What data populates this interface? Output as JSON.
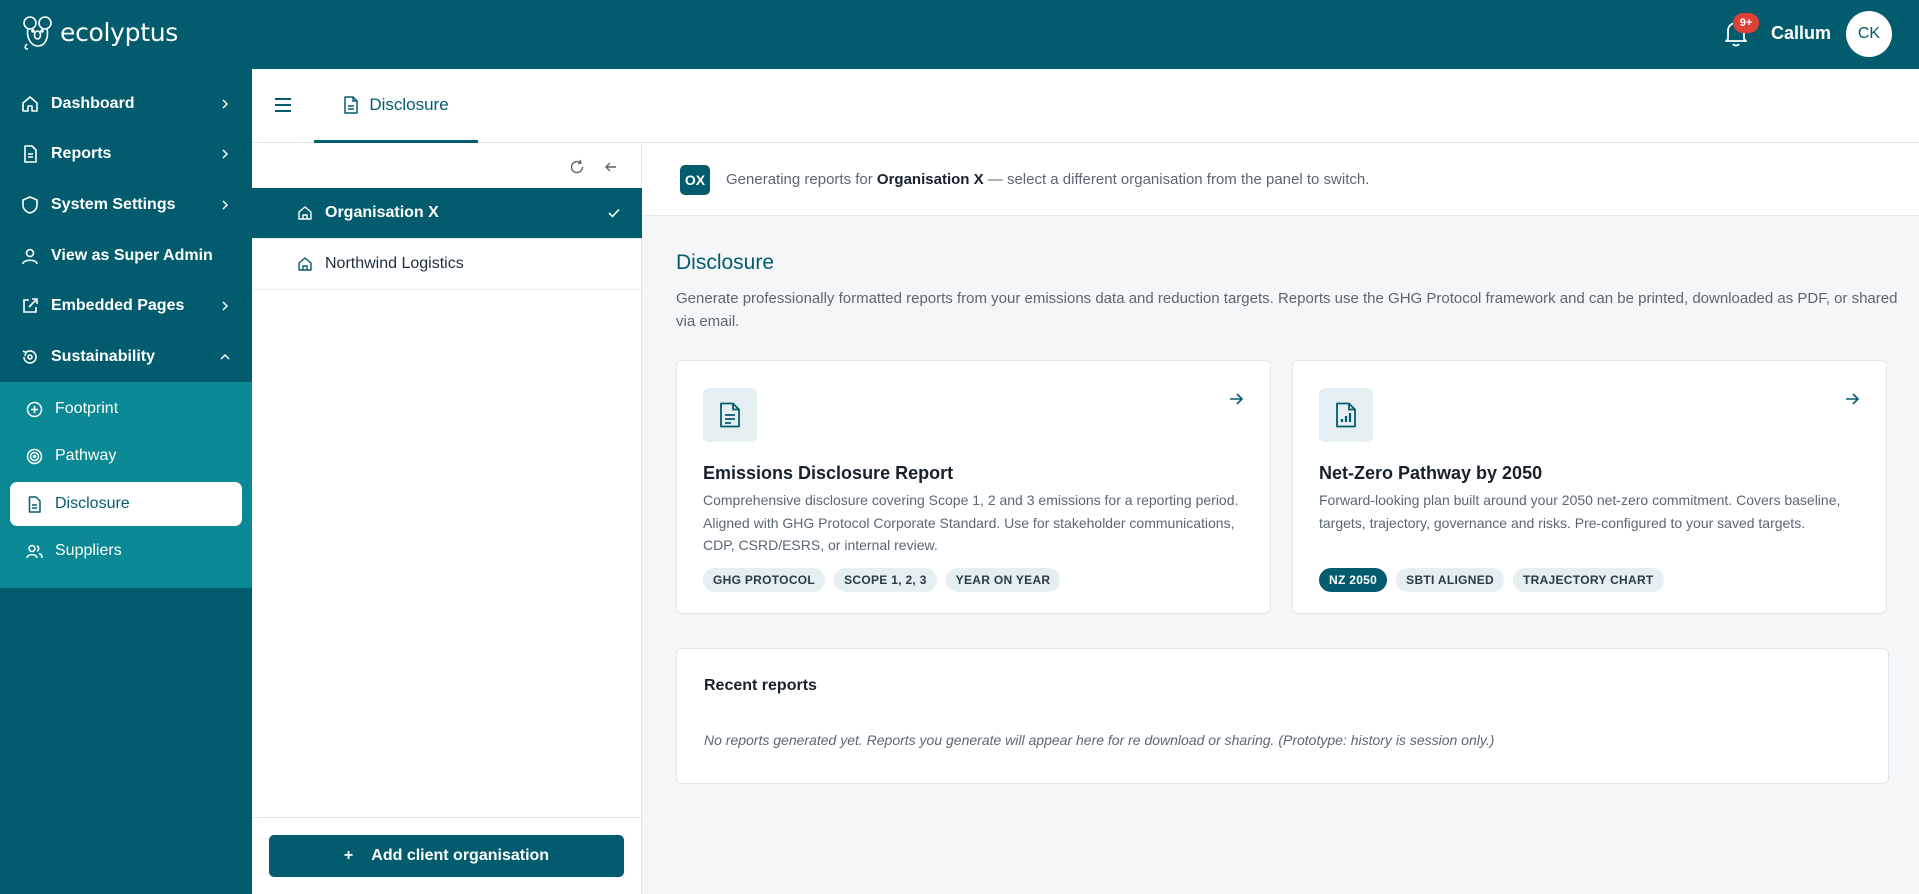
{
  "app": {
    "brand_name": "ecolyptus",
    "notification_badge": "9+",
    "user_name": "Callum",
    "user_initials": "CK"
  },
  "sidebar": {
    "items": [
      {
        "label": "Dashboard",
        "icon": "home-icon"
      },
      {
        "label": "Reports",
        "icon": "document-icon"
      },
      {
        "label": "System Settings",
        "icon": "shield-icon"
      },
      {
        "label": "View as Super Admin",
        "icon": "user-icon"
      },
      {
        "label": "Embedded Pages",
        "icon": "external-link-icon"
      },
      {
        "label": "Sustainability",
        "icon": "refresh-leaf-icon"
      }
    ],
    "sub_items": [
      {
        "label": "Footprint",
        "icon": "plus-circle-icon"
      },
      {
        "label": "Pathway",
        "icon": "target-icon"
      },
      {
        "label": "Disclosure",
        "icon": "document-icon",
        "active": true
      },
      {
        "label": "Suppliers",
        "icon": "users-icon"
      }
    ]
  },
  "tabbar": {
    "active_tab": "Disclosure"
  },
  "org_panel": {
    "organisations": [
      {
        "name": "Organisation X",
        "selected": true
      },
      {
        "name": "Northwind Logistics",
        "selected": false
      }
    ],
    "add_button_label": "Add client organisation",
    "add_button_icon": "+"
  },
  "context": {
    "badge": "OX",
    "prefix": "Generating reports for",
    "org": "Organisation X",
    "suffix": "— select a different organisation from the panel to switch."
  },
  "page": {
    "title": "Disclosure",
    "description": "Generate professionally formatted reports from your emissions data and reduction targets. Reports use the GHG Protocol framework and can be printed, downloaded as PDF, or shared via email."
  },
  "cards": [
    {
      "title": "Emissions Disclosure Report",
      "description": "Comprehensive disclosure covering Scope 1, 2 and 3 emissions for a reporting period. Aligned with GHG Protocol Corporate Standard. Use for stakeholder communications, CDP, CSRD/ESRS, or internal review.",
      "chips": [
        "GHG PROTOCOL",
        "SCOPE 1, 2, 3",
        "YEAR ON YEAR"
      ]
    },
    {
      "title": "Net-Zero Pathway by 2050",
      "description": "Forward-looking plan built around your 2050 net-zero commitment. Covers baseline, targets, trajectory, governance and risks. Pre-configured to your saved targets.",
      "chips": [
        "NZ 2050",
        "SBTI ALIGNED",
        "TRAJECTORY CHART"
      ]
    }
  ],
  "recent": {
    "title": "Recent reports",
    "empty_text": "No reports generated yet. Reports you generate will appear here for re download or sharing. (Prototype: history is session only.)"
  },
  "colors": {
    "primary": "#035c6e",
    "submenu": "#0a8893",
    "badge": "#e0403a"
  }
}
